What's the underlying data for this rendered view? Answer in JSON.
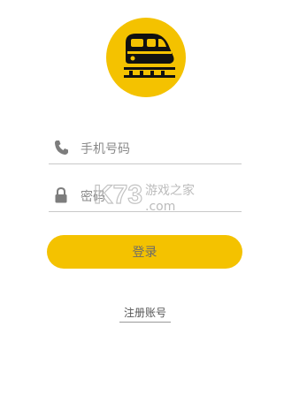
{
  "app": {
    "logo_icon": "train-icon",
    "accent_color": "#f4c200"
  },
  "form": {
    "phone": {
      "icon": "phone-icon",
      "placeholder": "手机号码",
      "value": ""
    },
    "password": {
      "icon": "lock-icon",
      "placeholder": "密码",
      "value": ""
    }
  },
  "actions": {
    "login_label": "登录",
    "register_label": "注册账号"
  },
  "watermark": {
    "brand": "K73",
    "tagline": "游戏之家",
    "domain": ".com"
  }
}
